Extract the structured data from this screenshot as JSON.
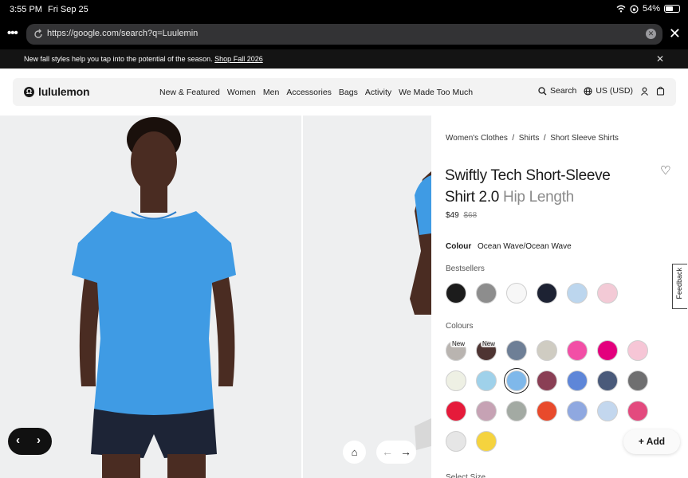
{
  "status": {
    "time": "3:55 PM",
    "date": "Fri Sep 25",
    "battery": "54%",
    "battery_level": 0.54
  },
  "browser": {
    "url": "https://google.com/search?q=Luulemin",
    "more_icon": "ellipsis-icon",
    "close_label": "✕"
  },
  "promo": {
    "text": "New fall styles help you tap into the potential of the season.",
    "link": "Shop Fall 2026"
  },
  "nav": {
    "logo": "lululemon",
    "items": [
      "New & Featured",
      "Women",
      "Men",
      "Accessories",
      "Bags",
      "Activity",
      "We Made Too Much"
    ],
    "search": "Search",
    "currency": "US (USD)"
  },
  "product": {
    "breadcrumb": [
      "Women's Clothes",
      "Shirts",
      "Short Sleeve Shirts"
    ],
    "title_main": "Swiftly Tech Short-Sleeve Shirt 2.0",
    "title_sub": "Hip Length",
    "price": "$49",
    "old_price": "$68",
    "colour_label": "Colour",
    "colour_value": "Ocean Wave/Ocean Wave",
    "bestsellers_label": "Bestsellers",
    "colours_label": "Colours",
    "new_badge": "New",
    "add_label": "Add",
    "size_label": "Select Size",
    "feedback": "Feedback"
  },
  "swatches": {
    "bestsellers": [
      "#1c1c1c",
      "#8d8d8d",
      "#f7f7f7",
      "#1d2233",
      "#bcd6ee",
      "#f3cad6"
    ],
    "colours": [
      [
        "#b9b4b0",
        "#4e3432",
        "#6e7f96",
        "#cfccc2",
        "#f24fa6",
        "#e3007d",
        "#f6c6d6"
      ],
      [
        "#eef0e4",
        "#9fd1ea",
        "#7fb8ea",
        "#8a3f55",
        "#5e86d8",
        "#4a5a7a",
        "#6f6f70"
      ],
      [
        "#e51a3a",
        "#c6a2b4",
        "#a3aaa3",
        "#e84a2c",
        "#8fa8e0",
        "#c3d7ee",
        "#e34a7e"
      ],
      [
        "#e6e6e6",
        "#f5d33e"
      ]
    ]
  },
  "colors": {
    "shirt": "#3f9be4",
    "skin": "#4a2c22",
    "shorts": "#1d2436"
  }
}
